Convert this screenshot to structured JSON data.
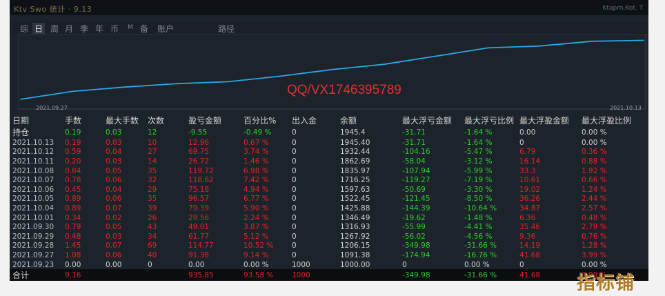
{
  "window": {
    "title": "Ktv Swo 统计 · 9.13",
    "corner": "Ktaprn.Kot. T"
  },
  "tabs": [
    "综",
    "日",
    "周",
    "月",
    "季",
    "年",
    "币",
    "M",
    "备",
    "账户",
    "路径"
  ],
  "active_tab": "日",
  "chart_data": {
    "type": "line",
    "x_start_label": "2021.09.27",
    "x_end_label": "2021.10.13",
    "x": [
      "2021.09.27",
      "2021.09.28",
      "2021.09.29",
      "2021.09.30",
      "2021.10.01",
      "2021.10.04",
      "2021.10.05",
      "2021.10.06",
      "2021.10.07",
      "2021.10.08",
      "2021.10.11",
      "2021.10.12",
      "2021.10.13"
    ],
    "values": [
      1091.38,
      1206.15,
      1267.92,
      1316.93,
      1346.49,
      1425.88,
      1522.45,
      1597.63,
      1716.25,
      1835.97,
      1862.69,
      1932.44,
      1945.4
    ],
    "color": "#27a8e6",
    "grid": false
  },
  "watermark": "QQ/VX1746395789",
  "brand": "指标铺",
  "columns": [
    "日期",
    "手数",
    "最大手数",
    "次数",
    "盈亏金额",
    "百分比%",
    "出入金",
    "余额",
    "最大浮亏金额",
    "最大浮亏比例",
    "最大浮盈金额",
    "最大浮盈比例"
  ],
  "hold_row": [
    "持仓",
    "0.19",
    "0.03",
    "12",
    "-9.55",
    "-0.49 %",
    "0",
    "1945.4",
    "-31.71",
    "-1.64 %",
    "0.00",
    "0.00 %"
  ],
  "rows": [
    [
      "2021.10.13",
      "0.19",
      "0.03",
      "10",
      "12.96",
      "0.67 %",
      "0",
      "1945.40",
      "-31.71",
      "-1.64 %",
      "0",
      "0.00 %"
    ],
    [
      "2021.10.12",
      "0.59",
      "0.04",
      "27",
      "69.75",
      "3.74 %",
      "0",
      "1932.44",
      "-104.16",
      "-5.47 %",
      "6.79",
      "0.36 %"
    ],
    [
      "2021.10.11",
      "0.20",
      "0.03",
      "14",
      "26.72",
      "1.46 %",
      "0",
      "1862.69",
      "-58.04",
      "-3.12 %",
      "16.14",
      "0.88 %"
    ],
    [
      "2021.10.08",
      "0.84",
      "0.05",
      "35",
      "119.72",
      "6.98 %",
      "0",
      "1835.97",
      "-107.94",
      "-5.99 %",
      "33.3",
      "1.92 %"
    ],
    [
      "2021.10.07",
      "0.78",
      "0.06",
      "32",
      "118.62",
      "7.42 %",
      "0",
      "1716.25",
      "-119.27",
      "-7.19 %",
      "10.61",
      "0.66 %"
    ],
    [
      "2021.10.06",
      "0.45",
      "0.04",
      "29",
      "75.18",
      "4.94 %",
      "0",
      "1597.63",
      "-50.69",
      "-3.30 %",
      "19.02",
      "1.24 %"
    ],
    [
      "2021.10.05",
      "0.89",
      "0.06",
      "35",
      "96.57",
      "6.77 %",
      "0",
      "1522.45",
      "-121.45",
      "-8.50 %",
      "36.26",
      "2.44 %"
    ],
    [
      "2021.10.04",
      "0.89",
      "0.07",
      "39",
      "79.39",
      "5.90 %",
      "0",
      "1425.88",
      "-144.39",
      "-10.64 %",
      "34.87",
      "2.57 %"
    ],
    [
      "2021.10.01",
      "0.34",
      "0.02",
      "26",
      "29.56",
      "2.24 %",
      "0",
      "1346.49",
      "-19.62",
      "-1.48 %",
      "6.36",
      "0.48 %"
    ],
    [
      "2021.09.30",
      "0.79",
      "0.05",
      "43",
      "49.01",
      "3.87 %",
      "0",
      "1316.93",
      "-55.99",
      "-4.41 %",
      "35.46",
      "2.79 %"
    ],
    [
      "2021.09.29",
      "0.48",
      "0.03",
      "34",
      "61.77",
      "5.12 %",
      "0",
      "1267.92",
      "-56.02",
      "-4.56 %",
      "9.36",
      "0.76 %"
    ],
    [
      "2021.09.28",
      "1.45",
      "0.07",
      "69",
      "114.77",
      "10.52 %",
      "0",
      "1206.15",
      "-349.98",
      "-31.66 %",
      "14.19",
      "1.28 %"
    ],
    [
      "2021.09.27",
      "1.08",
      "0.06",
      "40",
      "91.38",
      "9.14 %",
      "0",
      "1091.38",
      "-174.94",
      "-16.76 %",
      "41.68",
      "3.99 %"
    ],
    [
      "2021.09.23",
      "0.00",
      "0.00",
      "0",
      "0.00",
      "0.00 %",
      "1000",
      "1000.00",
      "0",
      "0.00 %",
      "0",
      "0.00 %"
    ]
  ],
  "total_row": [
    "合计",
    "9.16",
    "",
    "",
    "935.85",
    "93.58 %",
    "1000",
    "",
    "-349.98",
    "-31.66 %",
    "41.68",
    "3.99 %"
  ]
}
